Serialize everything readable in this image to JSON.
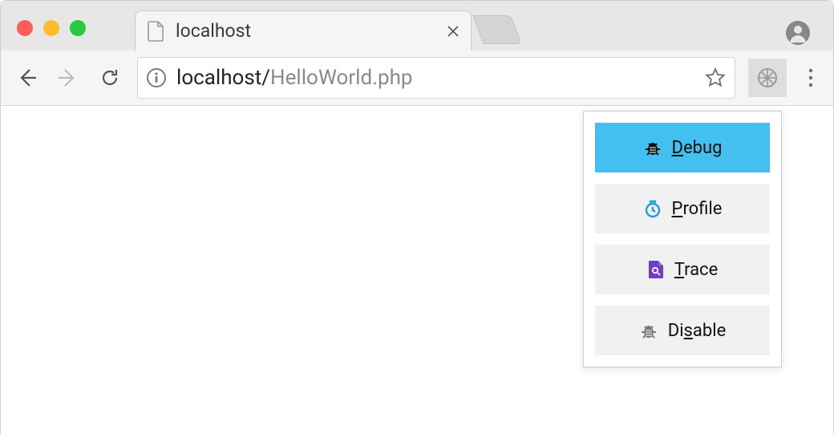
{
  "tab": {
    "title": "localhost"
  },
  "url": {
    "host": "localhost/",
    "path": "HelloWorld.php"
  },
  "popup": {
    "items": [
      {
        "id": "debug",
        "label_pre": "",
        "label_u": "D",
        "label_post": "ebug",
        "active": true,
        "icon": "bug",
        "icon_color": "#111111"
      },
      {
        "id": "profile",
        "label_pre": "",
        "label_u": "P",
        "label_post": "rofile",
        "active": false,
        "icon": "clock",
        "icon_color": "#1a9fe0"
      },
      {
        "id": "trace",
        "label_pre": "",
        "label_u": "T",
        "label_post": "race",
        "active": false,
        "icon": "magnify-doc",
        "icon_color": "#6f3bc9"
      },
      {
        "id": "disable",
        "label_pre": "Di",
        "label_u": "s",
        "label_post": "able",
        "active": false,
        "icon": "bug",
        "icon_color": "#7a7a7a"
      }
    ]
  }
}
